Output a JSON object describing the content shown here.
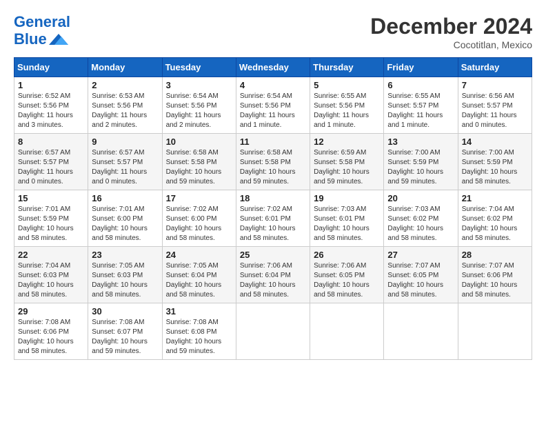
{
  "header": {
    "logo_line1": "General",
    "logo_line2": "Blue",
    "title": "December 2024",
    "subtitle": "Cocotitlan, Mexico"
  },
  "days_of_week": [
    "Sunday",
    "Monday",
    "Tuesday",
    "Wednesday",
    "Thursday",
    "Friday",
    "Saturday"
  ],
  "weeks": [
    [
      {
        "day": "1",
        "info": "Sunrise: 6:52 AM\nSunset: 5:56 PM\nDaylight: 11 hours and 3 minutes."
      },
      {
        "day": "2",
        "info": "Sunrise: 6:53 AM\nSunset: 5:56 PM\nDaylight: 11 hours and 2 minutes."
      },
      {
        "day": "3",
        "info": "Sunrise: 6:54 AM\nSunset: 5:56 PM\nDaylight: 11 hours and 2 minutes."
      },
      {
        "day": "4",
        "info": "Sunrise: 6:54 AM\nSunset: 5:56 PM\nDaylight: 11 hours and 1 minute."
      },
      {
        "day": "5",
        "info": "Sunrise: 6:55 AM\nSunset: 5:56 PM\nDaylight: 11 hours and 1 minute."
      },
      {
        "day": "6",
        "info": "Sunrise: 6:55 AM\nSunset: 5:57 PM\nDaylight: 11 hours and 1 minute."
      },
      {
        "day": "7",
        "info": "Sunrise: 6:56 AM\nSunset: 5:57 PM\nDaylight: 11 hours and 0 minutes."
      }
    ],
    [
      {
        "day": "8",
        "info": "Sunrise: 6:57 AM\nSunset: 5:57 PM\nDaylight: 11 hours and 0 minutes."
      },
      {
        "day": "9",
        "info": "Sunrise: 6:57 AM\nSunset: 5:57 PM\nDaylight: 11 hours and 0 minutes."
      },
      {
        "day": "10",
        "info": "Sunrise: 6:58 AM\nSunset: 5:58 PM\nDaylight: 10 hours and 59 minutes."
      },
      {
        "day": "11",
        "info": "Sunrise: 6:58 AM\nSunset: 5:58 PM\nDaylight: 10 hours and 59 minutes."
      },
      {
        "day": "12",
        "info": "Sunrise: 6:59 AM\nSunset: 5:58 PM\nDaylight: 10 hours and 59 minutes."
      },
      {
        "day": "13",
        "info": "Sunrise: 7:00 AM\nSunset: 5:59 PM\nDaylight: 10 hours and 59 minutes."
      },
      {
        "day": "14",
        "info": "Sunrise: 7:00 AM\nSunset: 5:59 PM\nDaylight: 10 hours and 58 minutes."
      }
    ],
    [
      {
        "day": "15",
        "info": "Sunrise: 7:01 AM\nSunset: 5:59 PM\nDaylight: 10 hours and 58 minutes."
      },
      {
        "day": "16",
        "info": "Sunrise: 7:01 AM\nSunset: 6:00 PM\nDaylight: 10 hours and 58 minutes."
      },
      {
        "day": "17",
        "info": "Sunrise: 7:02 AM\nSunset: 6:00 PM\nDaylight: 10 hours and 58 minutes."
      },
      {
        "day": "18",
        "info": "Sunrise: 7:02 AM\nSunset: 6:01 PM\nDaylight: 10 hours and 58 minutes."
      },
      {
        "day": "19",
        "info": "Sunrise: 7:03 AM\nSunset: 6:01 PM\nDaylight: 10 hours and 58 minutes."
      },
      {
        "day": "20",
        "info": "Sunrise: 7:03 AM\nSunset: 6:02 PM\nDaylight: 10 hours and 58 minutes."
      },
      {
        "day": "21",
        "info": "Sunrise: 7:04 AM\nSunset: 6:02 PM\nDaylight: 10 hours and 58 minutes."
      }
    ],
    [
      {
        "day": "22",
        "info": "Sunrise: 7:04 AM\nSunset: 6:03 PM\nDaylight: 10 hours and 58 minutes."
      },
      {
        "day": "23",
        "info": "Sunrise: 7:05 AM\nSunset: 6:03 PM\nDaylight: 10 hours and 58 minutes."
      },
      {
        "day": "24",
        "info": "Sunrise: 7:05 AM\nSunset: 6:04 PM\nDaylight: 10 hours and 58 minutes."
      },
      {
        "day": "25",
        "info": "Sunrise: 7:06 AM\nSunset: 6:04 PM\nDaylight: 10 hours and 58 minutes."
      },
      {
        "day": "26",
        "info": "Sunrise: 7:06 AM\nSunset: 6:05 PM\nDaylight: 10 hours and 58 minutes."
      },
      {
        "day": "27",
        "info": "Sunrise: 7:07 AM\nSunset: 6:05 PM\nDaylight: 10 hours and 58 minutes."
      },
      {
        "day": "28",
        "info": "Sunrise: 7:07 AM\nSunset: 6:06 PM\nDaylight: 10 hours and 58 minutes."
      }
    ],
    [
      {
        "day": "29",
        "info": "Sunrise: 7:08 AM\nSunset: 6:06 PM\nDaylight: 10 hours and 58 minutes."
      },
      {
        "day": "30",
        "info": "Sunrise: 7:08 AM\nSunset: 6:07 PM\nDaylight: 10 hours and 59 minutes."
      },
      {
        "day": "31",
        "info": "Sunrise: 7:08 AM\nSunset: 6:08 PM\nDaylight: 10 hours and 59 minutes."
      },
      null,
      null,
      null,
      null
    ]
  ]
}
